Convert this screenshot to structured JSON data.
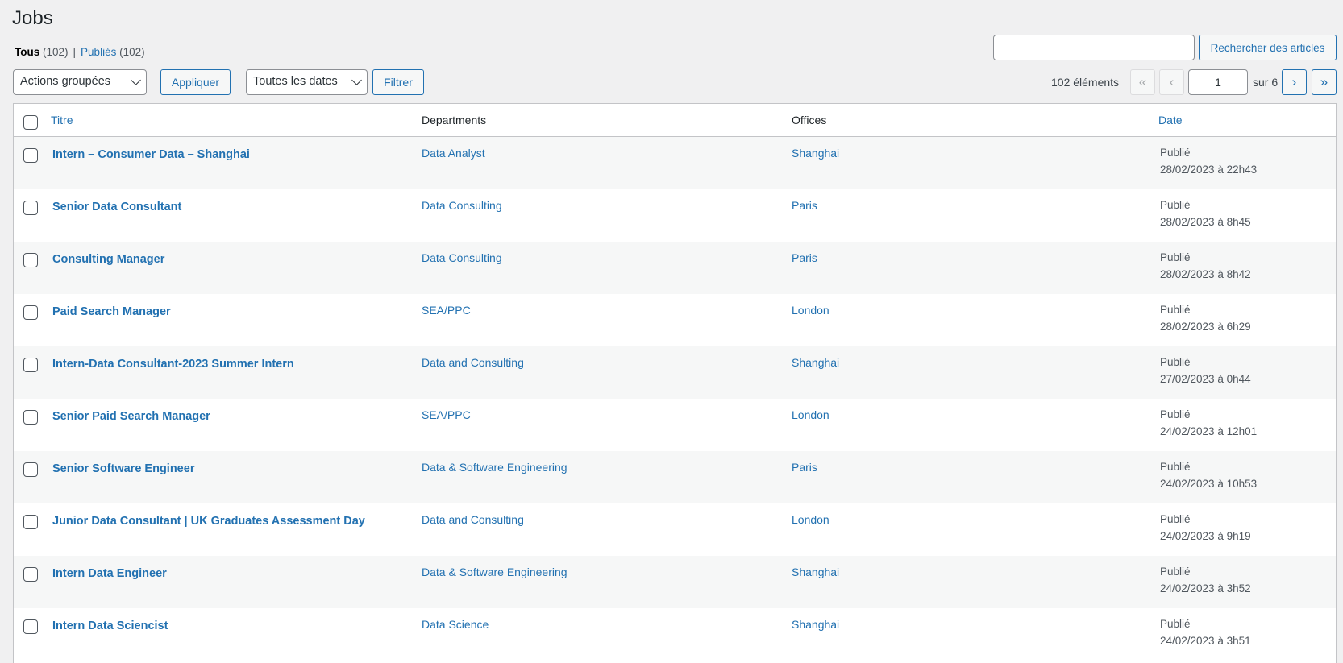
{
  "page": {
    "title": "Jobs"
  },
  "filters_links": {
    "all_label": "Tous",
    "all_count": "(102)",
    "sep": "|",
    "published_label": "Publiés",
    "published_count": "(102)"
  },
  "search": {
    "value": "",
    "button_label": "Rechercher des articles"
  },
  "toolbar": {
    "bulk_actions": "Actions groupées",
    "apply_label": "Appliquer",
    "dates_filter": "Toutes les dates",
    "filter_label": "Filtrer"
  },
  "pagination": {
    "count": "102 éléments",
    "first": "«",
    "prev": "‹",
    "current_page": "1",
    "of_label": "sur 6",
    "next": "›",
    "last": "»"
  },
  "table": {
    "headers": {
      "title": "Titre",
      "departments": "Departments",
      "offices": "Offices",
      "date": "Date"
    },
    "rows": [
      {
        "title": "Intern – Consumer Data – Shanghai",
        "department": "Data Analyst",
        "office": "Shanghai",
        "status": "Publié",
        "date": "28/02/2023 à 22h43"
      },
      {
        "title": "Senior Data Consultant",
        "department": "Data Consulting",
        "office": "Paris",
        "status": "Publié",
        "date": "28/02/2023 à 8h45"
      },
      {
        "title": "Consulting Manager",
        "department": "Data Consulting",
        "office": "Paris",
        "status": "Publié",
        "date": "28/02/2023 à 8h42"
      },
      {
        "title": "Paid Search Manager",
        "department": "SEA/PPC",
        "office": "London",
        "status": "Publié",
        "date": "28/02/2023 à 6h29"
      },
      {
        "title": "Intern-Data Consultant-2023 Summer Intern",
        "department": "Data and Consulting",
        "office": "Shanghai",
        "status": "Publié",
        "date": "27/02/2023 à 0h44"
      },
      {
        "title": "Senior Paid Search Manager",
        "department": "SEA/PPC",
        "office": "London",
        "status": "Publié",
        "date": "24/02/2023 à 12h01"
      },
      {
        "title": "Senior Software Engineer",
        "department": "Data & Software Engineering",
        "office": "Paris",
        "status": "Publié",
        "date": "24/02/2023 à 10h53"
      },
      {
        "title": "Junior Data Consultant | UK Graduates Assessment Day",
        "department": "Data and Consulting",
        "office": "London",
        "status": "Publié",
        "date": "24/02/2023 à 9h19"
      },
      {
        "title": "Intern Data Engineer",
        "department": "Data & Software Engineering",
        "office": "Shanghai",
        "status": "Publié",
        "date": "24/02/2023 à 3h52"
      },
      {
        "title": "Intern Data Sciencist",
        "department": "Data Science",
        "office": "Shanghai",
        "status": "Publié",
        "date": "24/02/2023 à 3h51"
      }
    ]
  }
}
